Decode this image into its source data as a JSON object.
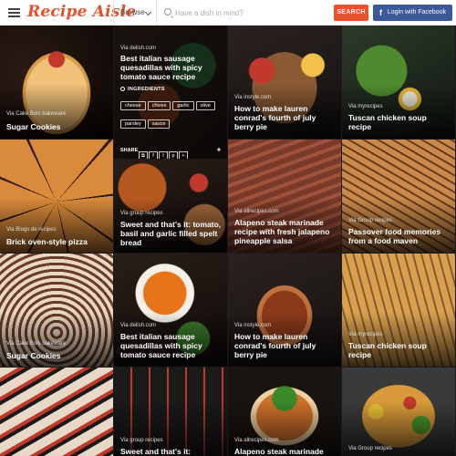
{
  "header": {
    "logo_text": "Recipe Aisle",
    "browse_label": "Browse",
    "search_placeholder": "Have a dish in mind?",
    "search_button": "SEARCH",
    "facebook_button": "Login with Facebook",
    "accent_color": "#e8512a",
    "facebook_color": "#3b5998"
  },
  "expanded_tile": {
    "via": "Via delish.com",
    "title": "Best italian sausage quesadillas with spicy tomato sauce recipe",
    "ingredients_label": "INGREDIENTS",
    "tags": [
      "cheese",
      "chives",
      "garlic",
      "olive",
      "parsley",
      "sauce"
    ],
    "share_label": "SHARE",
    "share_icons": [
      "copy-icon",
      "facebook-icon",
      "twitter-icon",
      "pinterest-icon",
      "plus-icon"
    ]
  },
  "tiles": [
    {
      "via": "Via Cake Bois bakeware",
      "title": "Sugar Cookies"
    },
    {
      "via": "Via delish.com",
      "title": "Best italian sausage quesadillas with spicy tomato sauce recipe"
    },
    {
      "via": "Via instyle.com",
      "title": "How to make lauren conrad's fourth of july berry pie"
    },
    {
      "via": "Via myrecipes",
      "title": "Tuscan chicken soup recipe"
    },
    {
      "via": "Via Blogs de recipes",
      "title": "Brick oven-style pizza"
    },
    {
      "via": "Via group recipes",
      "title": "Sweet and that's it: tomato, basil and garlic filled spelt bread"
    },
    {
      "via": "Via allrecipes.com",
      "title": "Alapeno steak marinade recipe with fresh jalapeno pineapple salsa"
    },
    {
      "via": "Via Group recipes",
      "title": "Passover food memories from a food maven"
    },
    {
      "via": "Via Cake Bois bakeware",
      "title": "Sugar Cookies"
    },
    {
      "via": "Via delish.com",
      "title": "Best italian sausage quesadillas with spicy tomato sauce recipe"
    },
    {
      "via": "Via instyle.com",
      "title": "How to make lauren conrad's fourth of july berry pie"
    },
    {
      "via": "Via myrecipes",
      "title": "Tuscan chicken soup recipe"
    },
    {
      "via": "",
      "title": ""
    },
    {
      "via": "Via group recipes",
      "title": "Sweet and that's it:"
    },
    {
      "via": "Via allrecipes.com",
      "title": "Alapeno steak marinade"
    },
    {
      "via": "Via Group recipes",
      "title": ""
    }
  ]
}
